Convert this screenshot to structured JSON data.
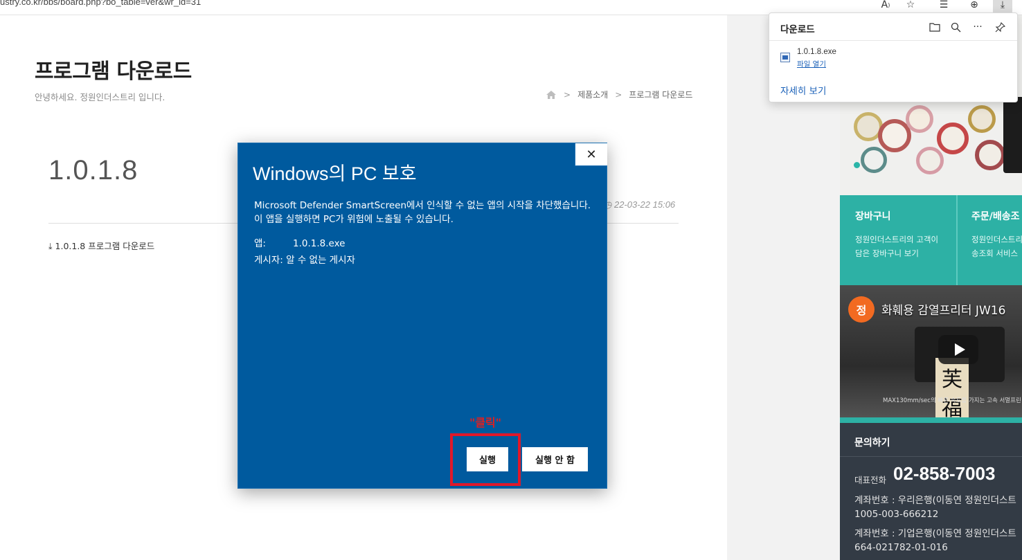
{
  "browser": {
    "url": "ustry.co.kr/bbs/board.php?bo_table=ver&wr_id=31",
    "icons": [
      "read-aloud-icon",
      "favorites-add-icon",
      "favorites-icon",
      "collections-icon",
      "downloads-icon"
    ]
  },
  "page": {
    "title": "프로그램 다운로드",
    "subtitle": "안녕하세요. 정원인더스트리 입니다.",
    "breadcrumb": [
      "제품소개",
      "프로그램 다운로드"
    ],
    "post": {
      "title": "1.0.1.8",
      "date": "22-03-22 15:06",
      "file_link": "1.0.1.8 프로그램 다운로드"
    }
  },
  "sidebar": {
    "shop": {
      "cart_title": "장바구니",
      "cart_desc_1": "정원인더스트리의 고객이",
      "cart_desc_2": "담은 장바구니 보기",
      "order_title": "주문/배송조",
      "order_desc_1": "정원인더스트리",
      "order_desc_2": "송조회 서비스"
    },
    "video": {
      "avatar": "정",
      "title": "화훼용 감열프리터 JW16",
      "caption": "MAX130mm/sec의 빠른 속도를 가지는 고속 서멀프린",
      "scroll_chars": [
        "芙",
        "福"
      ]
    },
    "contact": {
      "title": "문의하기",
      "phone_label": "대표전화",
      "phone": "02-858-7003",
      "bank1": "계좌번호 : 우리은행(이동연 정원인더스트",
      "bank1_no": "1005-003-666212",
      "bank2": "계좌번호 : 기업은행(이동연 정원인더스트",
      "bank2_no": "664-021782-01-016"
    }
  },
  "downloads": {
    "title": "다운로드",
    "file_name": "1.0.1.8.exe",
    "open_file": "파일 열기",
    "see_more": "자세히 보기"
  },
  "dialog": {
    "title": "Windows의 PC 보호",
    "message": "Microsoft Defender SmartScreen에서 인식할 수 없는 앱의 시작을 차단했습니다. 이 앱을 실행하면 PC가 위험에 노출될 수 있습니다.",
    "app_label": "앱:",
    "app_value": "1.0.1.8.exe",
    "publisher_label": "게시자:",
    "publisher_value": "알 수 없는 게시자",
    "annotation": "\"클릭\"",
    "run_button": "실행",
    "dont_run_button": "실행 안 함",
    "close_glyph": "✕"
  },
  "colors": {
    "dialog_blue": "#005a9e",
    "teal": "#2db1a5",
    "highlight_red": "#e0182a",
    "link_blue": "#1c62b9"
  }
}
